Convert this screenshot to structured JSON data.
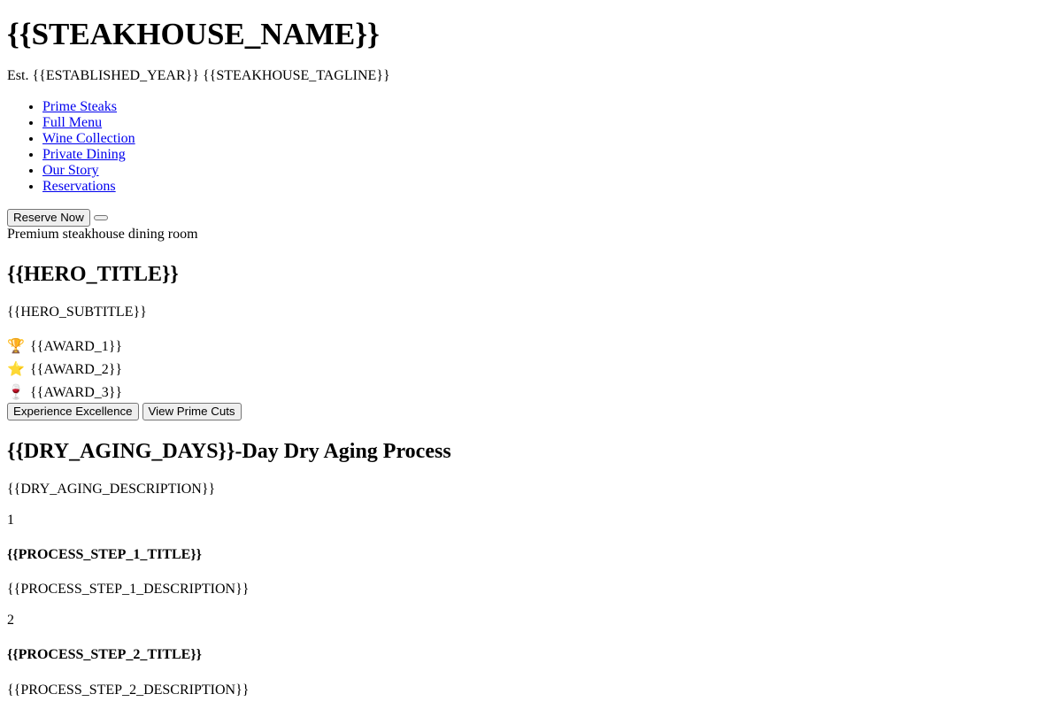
{
  "header": {
    "title": "{{STEAKHOUSE_NAME}}",
    "est_prefix": "Est.",
    "established_year": "{{ESTABLISHED_YEAR}}",
    "tagline": "{{STEAKHOUSE_TAGLINE}}"
  },
  "nav": {
    "items": [
      {
        "label": "Prime Steaks"
      },
      {
        "label": "Full Menu"
      },
      {
        "label": "Wine Collection"
      },
      {
        "label": "Private Dining"
      },
      {
        "label": "Our Story"
      },
      {
        "label": "Reservations"
      }
    ],
    "reserve_label": "Reserve Now",
    "menu_toggle_label": ""
  },
  "hero": {
    "image_alt": "Premium steakhouse dining room",
    "title": "{{HERO_TITLE}}",
    "subtitle": "{{HERO_SUBTITLE}}",
    "awards": [
      {
        "icon": "🏆",
        "icon_name": "trophy-icon",
        "text": "{{AWARD_1}}"
      },
      {
        "icon": "⭐",
        "icon_name": "star-icon",
        "text": "{{AWARD_2}}"
      },
      {
        "icon": "🍷",
        "icon_name": "wine-glass-icon",
        "text": "{{AWARD_3}}"
      }
    ],
    "cta_primary": "Experience Excellence",
    "cta_secondary": "View Prime Cuts"
  },
  "dry_aging": {
    "days": "{{DRY_AGING_DAYS}}",
    "title_suffix": "-Day Dry Aging Process",
    "description": "{{DRY_AGING_DESCRIPTION}}",
    "steps": [
      {
        "number": "1",
        "title": "{{PROCESS_STEP_1_TITLE}}",
        "description": "{{PROCESS_STEP_1_DESCRIPTION}}"
      },
      {
        "number": "2",
        "title": "{{PROCESS_STEP_2_TITLE}}",
        "description": "{{PROCESS_STEP_2_DESCRIPTION}}"
      }
    ]
  }
}
